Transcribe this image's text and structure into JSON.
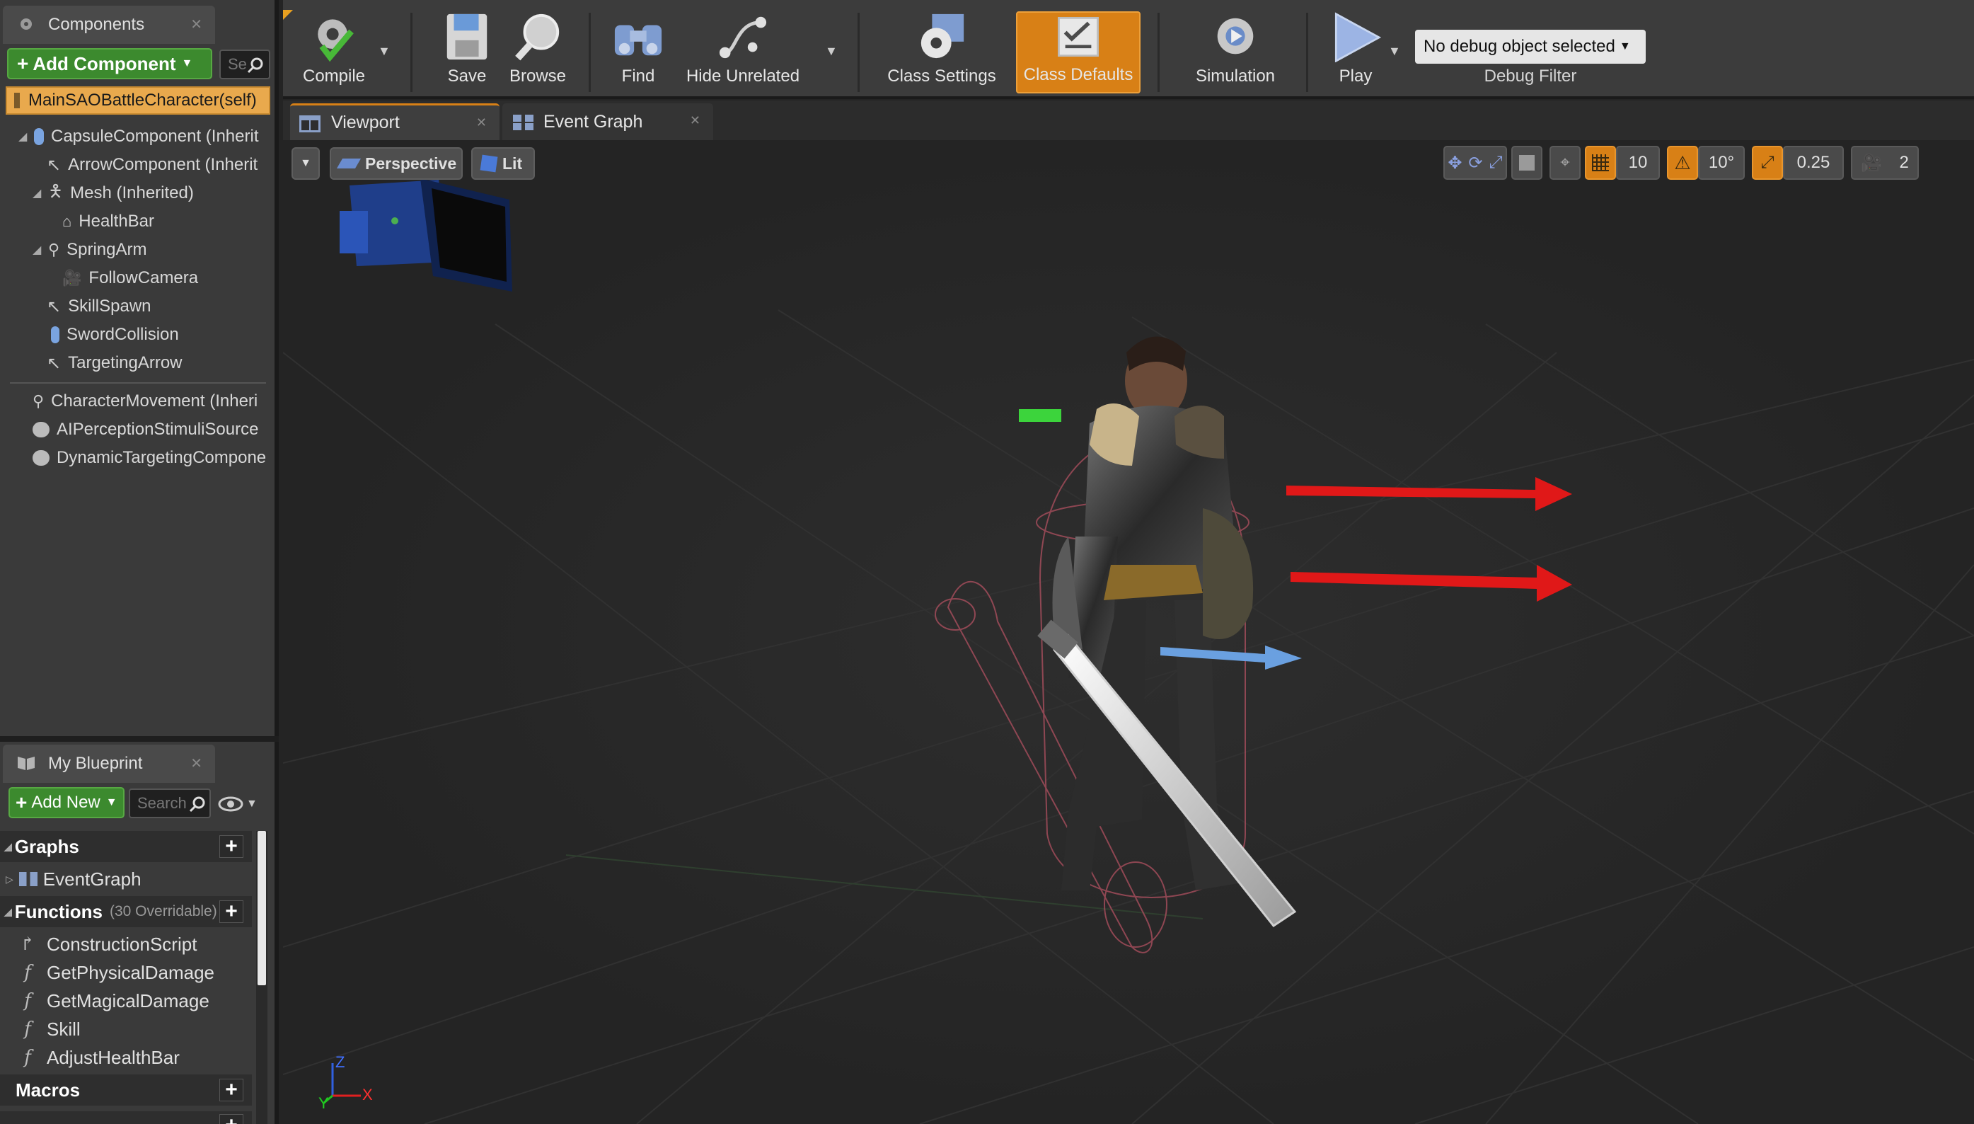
{
  "components_panel": {
    "tab_label": "Components",
    "add_component_label": "Add Component",
    "search_placeholder": "Se",
    "self_label": "MainSAOBattleCharacter(self)",
    "tree": [
      {
        "label": "CapsuleComponent (Inherit",
        "icon": "capsule-icon"
      },
      {
        "label": "ArrowComponent (Inherit",
        "icon": "arrow-icon"
      },
      {
        "label": "Mesh (Inherited)",
        "icon": "mesh-icon"
      },
      {
        "label": "HealthBar",
        "icon": "widget-icon"
      },
      {
        "label": "SpringArm",
        "icon": "springarm-icon"
      },
      {
        "label": "FollowCamera",
        "icon": "camera-icon"
      },
      {
        "label": "SkillSpawn",
        "icon": "arrow-icon"
      },
      {
        "label": "SwordCollision",
        "icon": "capsule-icon"
      },
      {
        "label": "TargetingArrow",
        "icon": "arrow-icon"
      }
    ],
    "actor_components": [
      {
        "label": "CharacterMovement (Inheri",
        "icon": "movement-icon"
      },
      {
        "label": "AIPerceptionStimuliSource",
        "icon": "component-icon"
      },
      {
        "label": "DynamicTargetingCompone",
        "icon": "component-icon"
      }
    ]
  },
  "my_blueprint": {
    "tab_label": "My Blueprint",
    "add_new_label": "Add New",
    "search_placeholder": "Search",
    "graphs_label": "Graphs",
    "event_graph_label": "EventGraph",
    "functions_label": "Functions",
    "functions_overridable": "(30 Overridable)",
    "functions": [
      "ConstructionScript",
      "GetPhysicalDamage",
      "GetMagicalDamage",
      "Skill",
      "AdjustHealthBar"
    ],
    "macros_label": "Macros"
  },
  "toolbar": {
    "compile": "Compile",
    "save": "Save",
    "browse": "Browse",
    "find": "Find",
    "hide_unrelated": "Hide Unrelated",
    "class_settings": "Class Settings",
    "class_defaults": "Class Defaults",
    "simulation": "Simulation",
    "play": "Play",
    "debug_object": "No debug object selected",
    "debug_filter": "Debug Filter"
  },
  "doc_tabs": {
    "viewport": "Viewport",
    "event_graph": "Event Graph"
  },
  "viewport": {
    "perspective": "Perspective",
    "lit": "Lit",
    "grid_snap": "10",
    "rotation_snap": "10°",
    "scale_snap": "0.25",
    "camera_speed": "2",
    "axis_z": "Z",
    "axis_y": "Y",
    "axis_x": "X"
  },
  "colors": {
    "accent_orange": "#d88016",
    "add_green": "#3c8a2e",
    "selected_row": "#e9a94d"
  }
}
